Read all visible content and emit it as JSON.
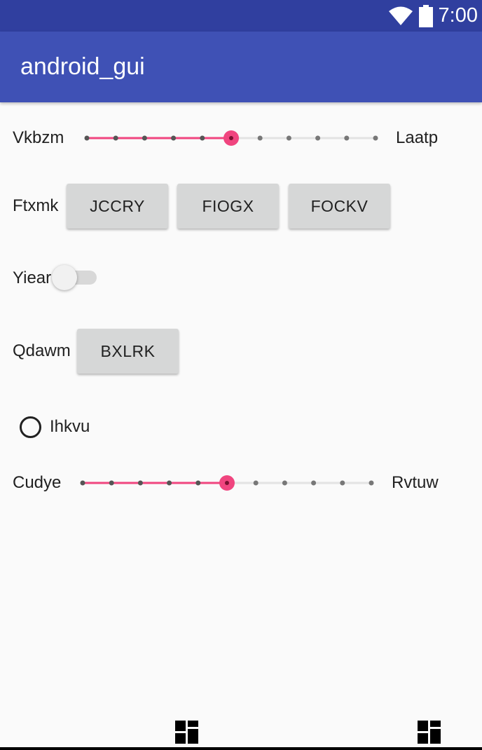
{
  "status_bar": {
    "time": "7:00",
    "icons": [
      "wifi-icon",
      "battery-icon"
    ]
  },
  "app_bar": {
    "title": "android_gui"
  },
  "colors": {
    "status_bar": "#303f9f",
    "app_bar": "#3f51b5",
    "accent": "#f0457f",
    "button": "#d6d7d7",
    "background": "#fafafa"
  },
  "rows": {
    "seek1": {
      "left_label": "Vkbzm",
      "right_label": "Laatp",
      "value": 5,
      "max": 10
    },
    "buttons": {
      "label": "Ftxmk",
      "items": [
        "JCCRY",
        "FIOGX",
        "FOCKV"
      ]
    },
    "switch": {
      "label": "Yiear",
      "checked": false
    },
    "single_button": {
      "label": "Qdawm",
      "button": "BXLRK"
    },
    "radio": {
      "label": "Ihkvu",
      "checked": false
    },
    "seek2": {
      "left_label": "Cudye",
      "right_label": "Rvtuw",
      "value": 5,
      "max": 10
    }
  },
  "bottom_icons": [
    "dashboard-icon",
    "dashboard-icon"
  ]
}
